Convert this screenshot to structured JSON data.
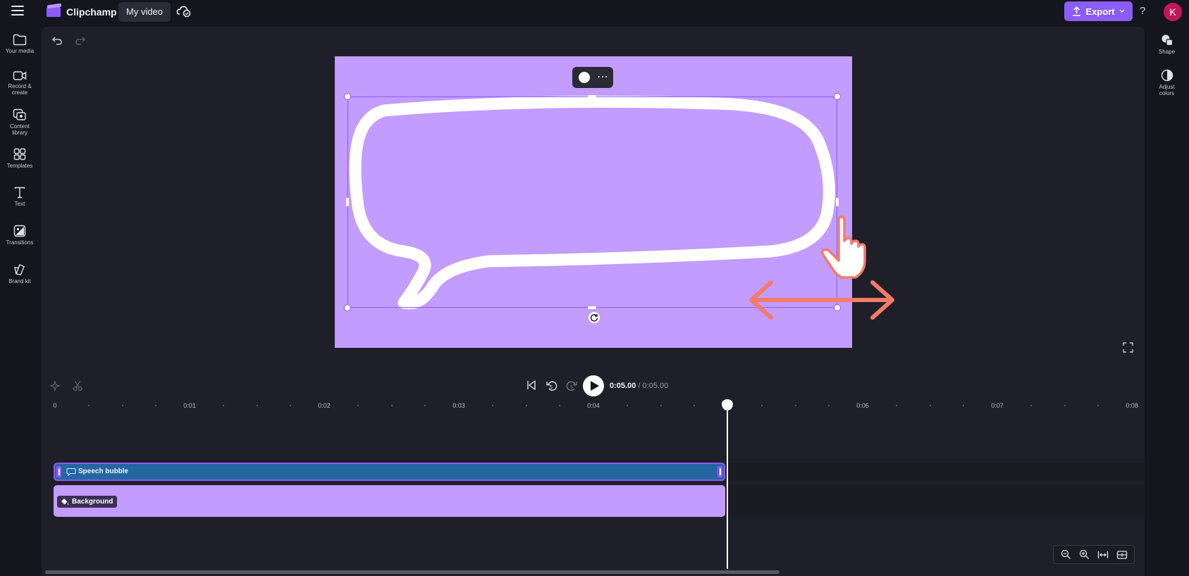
{
  "app": {
    "name": "Clipchamp",
    "project_title": "My video"
  },
  "header": {
    "export_label": "Export",
    "help_label": "?",
    "avatar_initial": "K"
  },
  "sidebar_left": [
    {
      "label": "Your media",
      "icon": "folder-icon"
    },
    {
      "label": "Record & create",
      "icon": "camera-icon"
    },
    {
      "label": "Content library",
      "icon": "content-library-icon"
    },
    {
      "label": "Templates",
      "icon": "templates-icon"
    },
    {
      "label": "Text",
      "icon": "text-icon"
    },
    {
      "label": "Transitions",
      "icon": "transitions-icon"
    },
    {
      "label": "Brand kit",
      "icon": "brand-kit-icon"
    }
  ],
  "sidebar_right": [
    {
      "label": "Shape",
      "icon": "shape-icon"
    },
    {
      "label": "Adjust colors",
      "icon": "adjust-colors-icon"
    }
  ],
  "playback": {
    "current_time": "0:05.00",
    "total_time": "/ 0:05.00",
    "skip_back_seconds": "5",
    "skip_forward_seconds": "5"
  },
  "timeline": {
    "ruler_labels": [
      "0",
      "0:01",
      "0:02",
      "0:03",
      "0:04",
      "0:06",
      "0:07",
      "0:08"
    ],
    "tracks": [
      {
        "name": "Speech bubble",
        "type": "shape",
        "color": "#2466a0"
      },
      {
        "name": "Background",
        "type": "color",
        "color": "#c29cfe"
      }
    ]
  },
  "canvas": {
    "background_color": "#c29cfe",
    "shape": "speech bubble outline",
    "selection_color": "#8c5ef5"
  },
  "colors": {
    "accent": "#8b5cf6",
    "avatar": "#c2185b",
    "gesture": "#f47a6c"
  }
}
